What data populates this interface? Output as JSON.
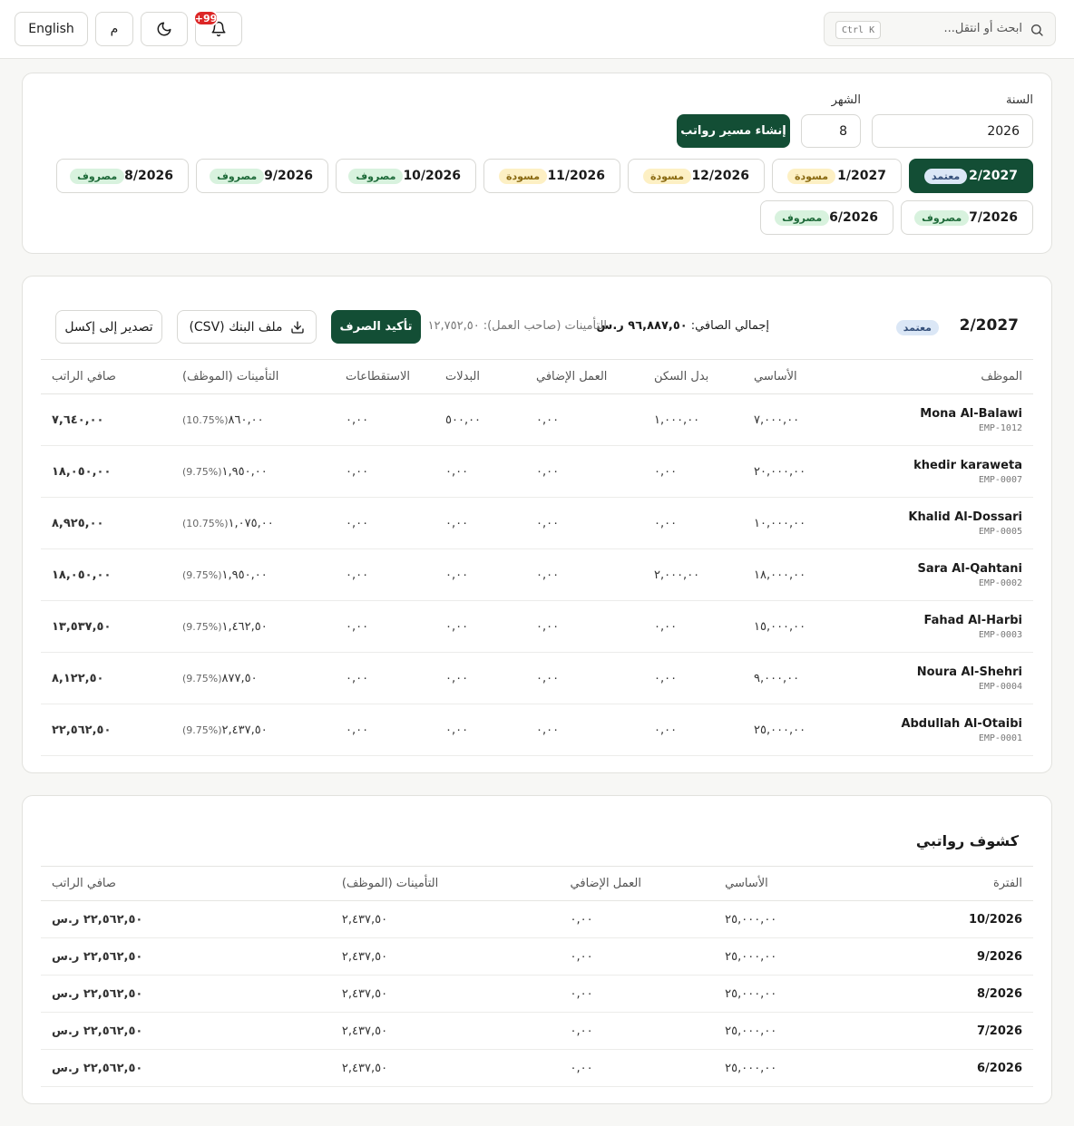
{
  "topbar": {
    "language_label": "English",
    "calendar_label": "م",
    "notification_count": "+99",
    "search_placeholder": "ابحث أو انتقل...",
    "search_shortcut": "Ctrl K"
  },
  "filters": {
    "year_label": "السنة",
    "year_value": "2026",
    "month_label": "الشهر",
    "month_value": "8",
    "create_button": "إنشاء مسير رواتب",
    "periods": [
      {
        "label": "2/2027",
        "status": "معتمد",
        "kind": "approved",
        "active": true
      },
      {
        "label": "1/2027",
        "status": "مسودة",
        "kind": "draft"
      },
      {
        "label": "12/2026",
        "status": "مسودة",
        "kind": "draft"
      },
      {
        "label": "11/2026",
        "status": "مسودة",
        "kind": "draft"
      },
      {
        "label": "10/2026",
        "status": "مصروف",
        "kind": "paid"
      },
      {
        "label": "9/2026",
        "status": "مصروف",
        "kind": "paid"
      },
      {
        "label": "8/2026",
        "status": "مصروف",
        "kind": "paid"
      },
      {
        "label": "7/2026",
        "status": "مصروف",
        "kind": "paid"
      },
      {
        "label": "6/2026",
        "status": "مصروف",
        "kind": "paid"
      }
    ]
  },
  "payroll": {
    "period": "2/2027",
    "status": "معتمد",
    "net_total_label": "إجمالي الصافي:",
    "net_total_value": "٩٦,٨٨٧,٥٠ ر.س",
    "employer_ins_label": "التأمينات (صاحب العمل):",
    "employer_ins_value": "١٢,٧٥٢,٥٠",
    "confirm_button": "تأكيد الصرف",
    "bank_file_button": "ملف البنك (CSV)",
    "export_button": "تصدير إلى إكسل",
    "columns": [
      "الموظف",
      "الأساسي",
      "بدل السكن",
      "العمل الإضافي",
      "البدلات",
      "الاستقطاعات",
      "التأمينات (الموظف)",
      "صافي الراتب"
    ],
    "rows": [
      {
        "name": "Mona Al-Balawi",
        "code": "EMP-1012",
        "basic": "٧,٠٠٠,٠٠",
        "housing": "١,٠٠٠,٠٠",
        "overtime": "٠,٠٠",
        "allowances": "٥٠٠,٠٠",
        "deductions": "٠,٠٠",
        "ins": "٨٦٠,٠٠",
        "rate": "(10.75%)",
        "net": "٧,٦٤٠,٠٠"
      },
      {
        "name": "khedir karaweta",
        "code": "EMP-0007",
        "basic": "٢٠,٠٠٠,٠٠",
        "housing": "٠,٠٠",
        "overtime": "٠,٠٠",
        "allowances": "٠,٠٠",
        "deductions": "٠,٠٠",
        "ins": "١,٩٥٠,٠٠",
        "rate": "(9.75%)",
        "net": "١٨,٠٥٠,٠٠"
      },
      {
        "name": "Khalid Al-Dossari",
        "code": "EMP-0005",
        "basic": "١٠,٠٠٠,٠٠",
        "housing": "٠,٠٠",
        "overtime": "٠,٠٠",
        "allowances": "٠,٠٠",
        "deductions": "٠,٠٠",
        "ins": "١,٠٧٥,٠٠",
        "rate": "(10.75%)",
        "net": "٨,٩٢٥,٠٠"
      },
      {
        "name": "Sara Al-Qahtani",
        "code": "EMP-0002",
        "basic": "١٨,٠٠٠,٠٠",
        "housing": "٢,٠٠٠,٠٠",
        "overtime": "٠,٠٠",
        "allowances": "٠,٠٠",
        "deductions": "٠,٠٠",
        "ins": "١,٩٥٠,٠٠",
        "rate": "(9.75%)",
        "net": "١٨,٠٥٠,٠٠"
      },
      {
        "name": "Fahad Al-Harbi",
        "code": "EMP-0003",
        "basic": "١٥,٠٠٠,٠٠",
        "housing": "٠,٠٠",
        "overtime": "٠,٠٠",
        "allowances": "٠,٠٠",
        "deductions": "٠,٠٠",
        "ins": "١,٤٦٢,٥٠",
        "rate": "(9.75%)",
        "net": "١٣,٥٣٧,٥٠"
      },
      {
        "name": "Noura Al-Shehri",
        "code": "EMP-0004",
        "basic": "٩,٠٠٠,٠٠",
        "housing": "٠,٠٠",
        "overtime": "٠,٠٠",
        "allowances": "٠,٠٠",
        "deductions": "٠,٠٠",
        "ins": "٨٧٧,٥٠",
        "rate": "(9.75%)",
        "net": "٨,١٢٢,٥٠"
      },
      {
        "name": "Abdullah Al-Otaibi",
        "code": "EMP-0001",
        "basic": "٢٥,٠٠٠,٠٠",
        "housing": "٠,٠٠",
        "overtime": "٠,٠٠",
        "allowances": "٠,٠٠",
        "deductions": "٠,٠٠",
        "ins": "٢,٤٣٧,٥٠",
        "rate": "(9.75%)",
        "net": "٢٢,٥٦٢,٥٠"
      }
    ]
  },
  "payslips": {
    "title": "كشوف رواتبي",
    "columns": [
      "الفترة",
      "الأساسي",
      "العمل الإضافي",
      "التأمينات (الموظف)",
      "صافي الراتب"
    ],
    "rows": [
      {
        "period": "10/2026",
        "basic": "٢٥,٠٠٠,٠٠",
        "overtime": "٠,٠٠",
        "ins": "٢,٤٣٧,٥٠",
        "net": "٢٢,٥٦٢,٥٠ ر.س"
      },
      {
        "period": "9/2026",
        "basic": "٢٥,٠٠٠,٠٠",
        "overtime": "٠,٠٠",
        "ins": "٢,٤٣٧,٥٠",
        "net": "٢٢,٥٦٢,٥٠ ر.س"
      },
      {
        "period": "8/2026",
        "basic": "٢٥,٠٠٠,٠٠",
        "overtime": "٠,٠٠",
        "ins": "٢,٤٣٧,٥٠",
        "net": "٢٢,٥٦٢,٥٠ ر.س"
      },
      {
        "period": "7/2026",
        "basic": "٢٥,٠٠٠,٠٠",
        "overtime": "٠,٠٠",
        "ins": "٢,٤٣٧,٥٠",
        "net": "٢٢,٥٦٢,٥٠ ر.س"
      },
      {
        "period": "6/2026",
        "basic": "٢٥,٠٠٠,٠٠",
        "overtime": "٠,٠٠",
        "ins": "٢,٤٣٧,٥٠",
        "net": "٢٢,٥٦٢,٥٠ ر.س"
      }
    ]
  },
  "colors": {
    "primary": "#134e35",
    "net_text": "#1f6b3a",
    "badge": "#dc2626"
  }
}
